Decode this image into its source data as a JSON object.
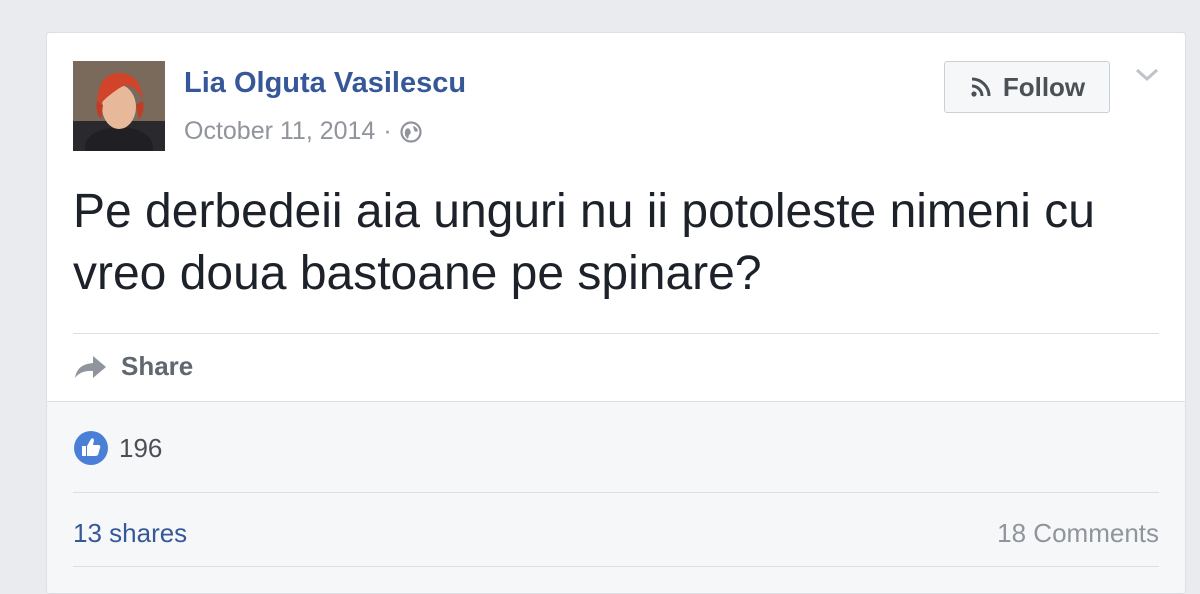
{
  "post": {
    "author": "Lia Olguta Vasilescu",
    "date": "October 11, 2014",
    "separator": "·",
    "privacy_icon": "globe-icon",
    "text": "Pe derbedeii aia unguri nu ii potoleste nimeni cu vreo doua bastoane pe spinare?",
    "follow_label": "Follow",
    "share_label": "Share"
  },
  "stats": {
    "likes": "196",
    "shares": "13 shares",
    "comments": "18 Comments"
  },
  "colors": {
    "link": "#365899",
    "like_blue": "#4267b2",
    "muted": "#90949c"
  }
}
